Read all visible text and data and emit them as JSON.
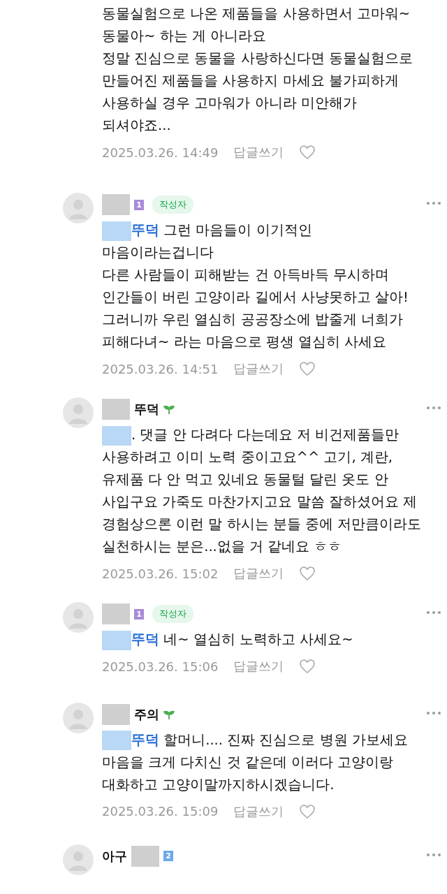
{
  "comments": [
    {
      "body": [
        {
          "kind": "text",
          "text": "동물실험으로 나온 제품들을 사용하면서 고마워~ 동물아~ 하는 게 아니라요\n정말 진심으로 동물을 사랑하신다면 동물실험으로 만들어진 제품들을 사용하지 마세요 불가피하게 사용하실 경우 고마워가 아니라 미안해가 되셔야죠..."
        }
      ],
      "date": "2025.03.26. 14:49",
      "reply": "답글쓰기",
      "liked": false
    },
    {
      "author": [
        {
          "kind": "redacted"
        },
        {
          "kind": "level",
          "text": "1",
          "color": "#a78bd8"
        },
        {
          "kind": "writer",
          "text": "작성자"
        }
      ],
      "body": [
        {
          "kind": "redacted"
        },
        {
          "kind": "mention",
          "text": "뚜덕"
        },
        {
          "kind": "text",
          "text": " 그런 마음들이 이기적인 마음이라는겁니다\n다른 사람들이 피해받는 건 아득바득 무시하며 인간들이 버린 고양이라 길에서 사냥못하고 살아! 그러니까 우린 열심히 공공장소에 밥줄게 너희가 피해다녀~ 라는 마음으로 평생 열심히 사세요"
        }
      ],
      "date": "2025.03.26. 14:51",
      "reply": "답글쓰기",
      "liked": false
    },
    {
      "author": [
        {
          "kind": "redacted"
        },
        {
          "kind": "name",
          "text": "뚜덕"
        },
        {
          "kind": "sprout"
        }
      ],
      "body": [
        {
          "kind": "redacted"
        },
        {
          "kind": "text",
          "text": ". 댓글 안 다려다 다는데요 저 비건제품들만 사용하려고 이미 노력 중이고요^^ 고기, 계란, 유제품 다 안 먹고 있네요 동물털 달린 옷도 안 사입구요 가죽도 마찬가지고요 말씀 잘하셨어요 제 경험상으론 이런 말 하시는 분들 중에 저만큼이라도 실천하시는 분은...없을 거 같네요 ㅎㅎ"
        }
      ],
      "date": "2025.03.26. 15:02",
      "reply": "답글쓰기",
      "liked": false
    },
    {
      "author": [
        {
          "kind": "redacted"
        },
        {
          "kind": "level",
          "text": "1",
          "color": "#a78bd8"
        },
        {
          "kind": "writer",
          "text": "작성자"
        }
      ],
      "body": [
        {
          "kind": "redacted"
        },
        {
          "kind": "mention",
          "text": "뚜덕"
        },
        {
          "kind": "text",
          "text": " 네~ 열심히 노력하고 사세요~"
        }
      ],
      "date": "2025.03.26. 15:06",
      "reply": "답글쓰기",
      "liked": false
    },
    {
      "author": [
        {
          "kind": "redacted"
        },
        {
          "kind": "name",
          "text": "주의"
        },
        {
          "kind": "sprout"
        }
      ],
      "body": [
        {
          "kind": "redacted"
        },
        {
          "kind": "mention",
          "text": "뚜덕"
        },
        {
          "kind": "text",
          "text": " 할머니.... 진짜 진심으로 병원 가보세요\n마음을 크게 다치신 것 같은데 이러다 고양이랑 대화하고 고양이말까지하시겠습니다."
        }
      ],
      "date": "2025.03.26. 15:09",
      "reply": "답글쓰기",
      "liked": false
    },
    {
      "author": [
        {
          "kind": "name",
          "text": "아구"
        },
        {
          "kind": "redacted"
        },
        {
          "kind": "level",
          "text": "2",
          "color": "#6fa8e8"
        }
      ]
    }
  ]
}
